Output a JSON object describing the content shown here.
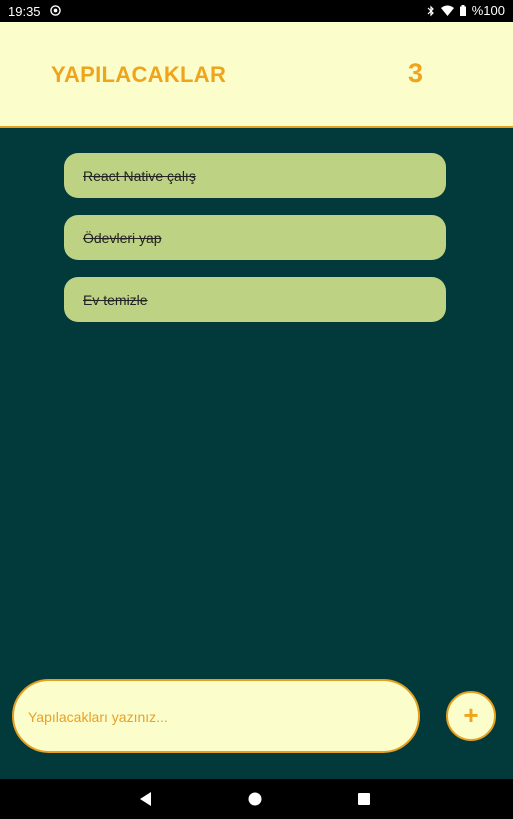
{
  "status_bar": {
    "time": "19:35",
    "battery": "%100",
    "icons": [
      "sync-icon",
      "bluetooth-icon",
      "wifi-icon",
      "battery-icon"
    ]
  },
  "header": {
    "title": "YAPILACAKLAR",
    "count": "3"
  },
  "todos": [
    {
      "text": "React Native çalış",
      "completed": true
    },
    {
      "text": "Ödevleri yap",
      "completed": true
    },
    {
      "text": "Ev temizle",
      "completed": true
    }
  ],
  "input": {
    "placeholder": "Yapılacakları yazınız...",
    "value": ""
  },
  "add_button": {
    "label": "+"
  },
  "nav_bar": {
    "icons": [
      "back-icon",
      "home-icon",
      "recents-icon"
    ]
  },
  "colors": {
    "background": "#023a3c",
    "header_bg": "#fbfdca",
    "accent": "#f0a41c",
    "todo_bg": "#bdd383"
  }
}
